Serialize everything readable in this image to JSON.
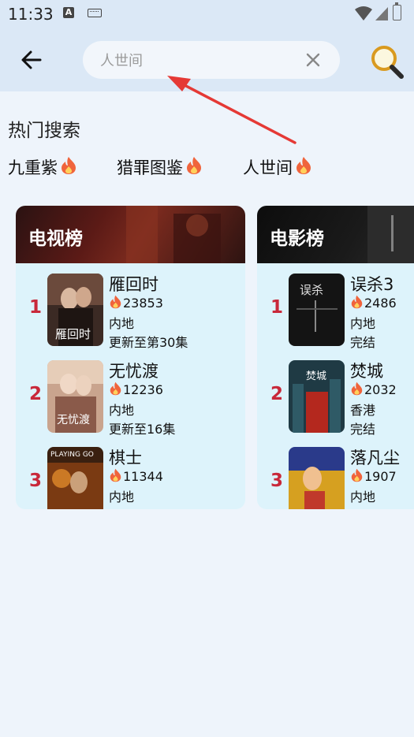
{
  "status_bar": {
    "time": "11:33"
  },
  "search": {
    "placeholder": "人世间"
  },
  "hot_search": {
    "title": "热门搜索",
    "items": [
      {
        "label": "九重紫"
      },
      {
        "label": "猎罪图鉴"
      },
      {
        "label": "人世间"
      }
    ]
  },
  "tv_ranking": {
    "title": "电视榜",
    "items": [
      {
        "rank": "1",
        "title": "雁回时",
        "heat": "23853",
        "region": "内地",
        "status": "更新至第30集"
      },
      {
        "rank": "2",
        "title": "无忧渡",
        "heat": "12236",
        "region": "内地",
        "status": "更新至16集"
      },
      {
        "rank": "3",
        "title": "棋士",
        "heat": "11344",
        "region": "内地",
        "status": ""
      }
    ]
  },
  "movie_ranking": {
    "title": "电影榜",
    "items": [
      {
        "rank": "1",
        "title": "误杀3",
        "heat": "2486",
        "region": "内地",
        "status": "完结"
      },
      {
        "rank": "2",
        "title": "焚城",
        "heat": "2032",
        "region": "香港",
        "status": "完结"
      },
      {
        "rank": "3",
        "title": "落凡尘",
        "heat": "1907",
        "region": "内地",
        "status": ""
      }
    ]
  },
  "colors": {
    "header_bg": "#dbe8f6",
    "page_bg": "#eef4fb",
    "card_bg": "#ddf3fb",
    "rank_red": "#c8283a",
    "annotation_arrow": "#e53935"
  }
}
